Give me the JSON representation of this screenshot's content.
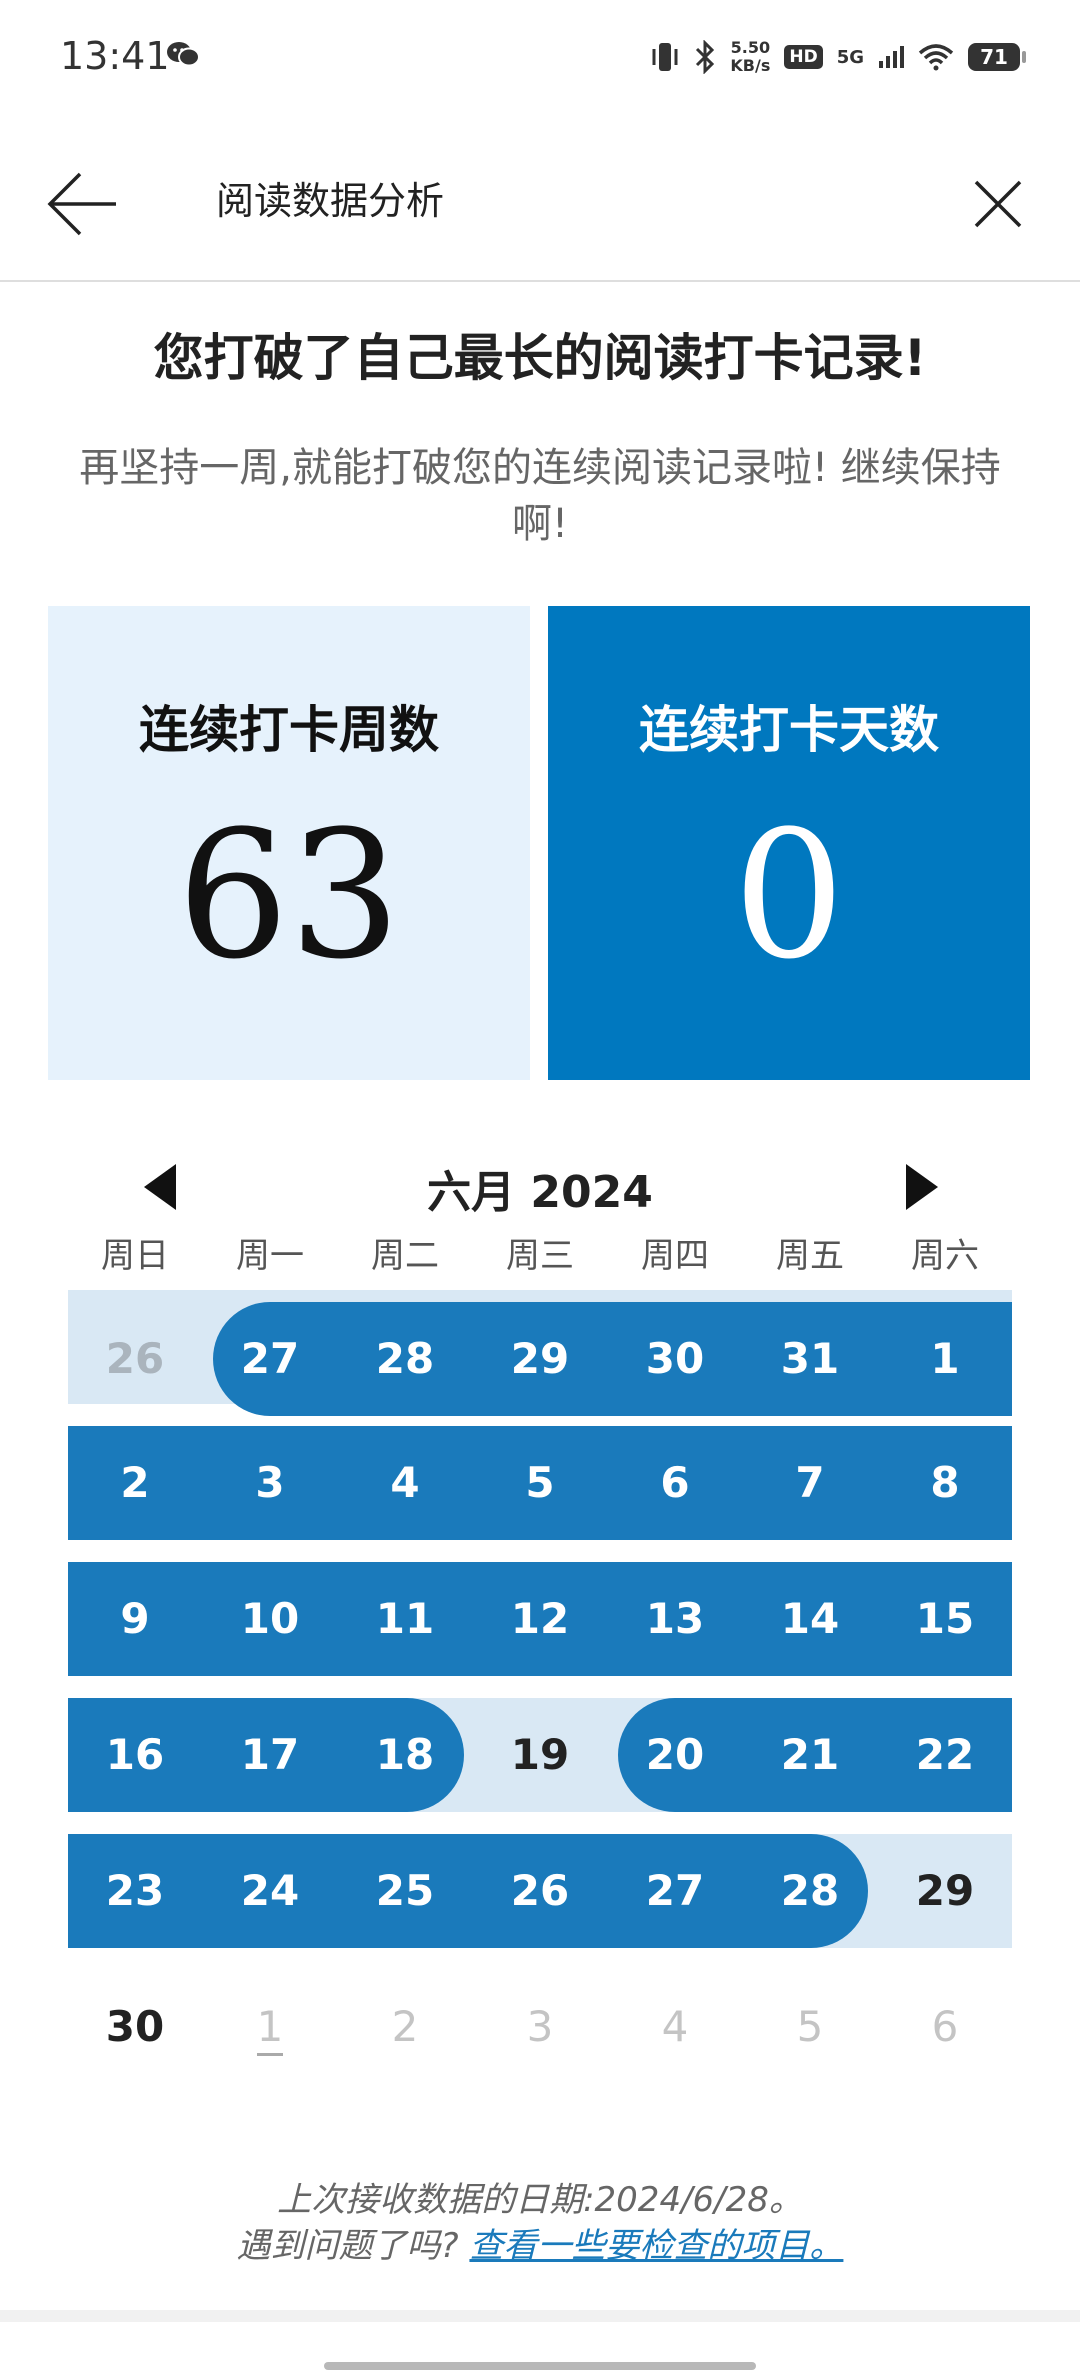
{
  "status_bar": {
    "time": "13:41",
    "net_speed_value": "5.50",
    "net_speed_unit": "KB/s",
    "hd": "HD",
    "network": "5G",
    "battery": "71"
  },
  "app_bar": {
    "title": "阅读数据分析"
  },
  "headline": "您打破了自己最长的阅读打卡记录!",
  "subline": "再坚持一周,就能打破您的连续阅读记录啦! 继续保持啊!",
  "stats": {
    "weeks_label": "连续打卡周数",
    "weeks_value": "63",
    "days_label": "连续打卡天数",
    "days_value": "0"
  },
  "calendar": {
    "month_label": "六月 2024",
    "weekdays": [
      "周日",
      "周一",
      "周二",
      "周三",
      "周四",
      "周五",
      "周六"
    ],
    "rows": [
      [
        "26",
        "27",
        "28",
        "29",
        "30",
        "31",
        "1"
      ],
      [
        "2",
        "3",
        "4",
        "5",
        "6",
        "7",
        "8"
      ],
      [
        "9",
        "10",
        "11",
        "12",
        "13",
        "14",
        "15"
      ],
      [
        "16",
        "17",
        "18",
        "19",
        "20",
        "21",
        "22"
      ],
      [
        "23",
        "24",
        "25",
        "26",
        "27",
        "28",
        "29"
      ],
      [
        "30",
        "1",
        "2",
        "3",
        "4",
        "5",
        "6"
      ]
    ]
  },
  "footer": {
    "last_sync": "上次接收数据的日期:2024/6/28。",
    "problem_prefix": "遇到问题了吗?",
    "problem_link": "查看一些要检查的项目。"
  },
  "colors": {
    "accent": "#0078bf",
    "streak": "#1a7abb",
    "week_bg": "#d9e8f4",
    "card_light": "#e6f2fc"
  }
}
